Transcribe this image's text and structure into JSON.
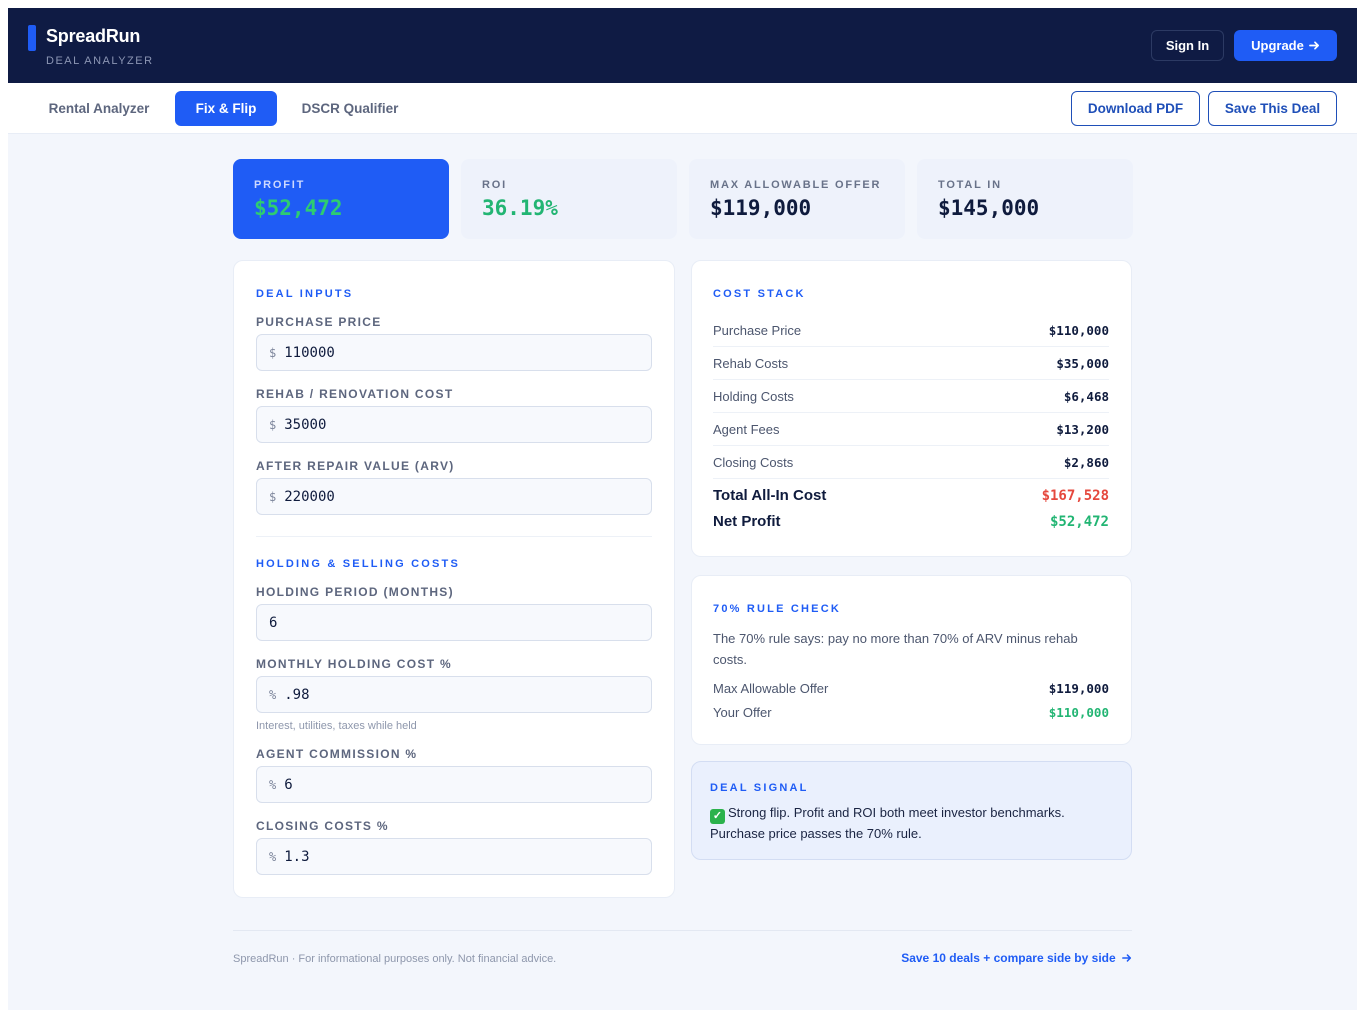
{
  "header": {
    "brand_name": "SpreadRun",
    "brand_subtitle": "DEAL ANALYZER",
    "sign_in_label": "Sign In",
    "upgrade_label": "Upgrade",
    "upgrade_icon": "arrow-right-icon"
  },
  "tabs": [
    {
      "label": "Rental Analyzer",
      "active": false
    },
    {
      "label": "Fix & Flip",
      "active": true
    },
    {
      "label": "DSCR Qualifier",
      "active": false
    }
  ],
  "actions": {
    "download_pdf_label": "Download PDF",
    "save_deal_label": "Save This Deal"
  },
  "metrics": [
    {
      "label": "PROFIT",
      "value": "$52,472"
    },
    {
      "label": "ROI",
      "value": "36.19%"
    },
    {
      "label": "MAX ALLOWABLE OFFER",
      "value": "$119,000"
    },
    {
      "label": "TOTAL IN",
      "value": "$145,000"
    }
  ],
  "inputs": {
    "deal_section_title": "DEAL INPUTS",
    "purchase_price": {
      "label": "PURCHASE PRICE",
      "prefix": "$",
      "value": "110000"
    },
    "rehab_cost": {
      "label": "REHAB / RENOVATION COST",
      "prefix": "$",
      "value": "35000"
    },
    "arv": {
      "label": "AFTER REPAIR VALUE (ARV)",
      "prefix": "$",
      "value": "220000"
    },
    "holding_section_title": "HOLDING & SELLING COSTS",
    "holding_period": {
      "label": "HOLDING PERIOD (MONTHS)",
      "value": "6"
    },
    "monthly_holding": {
      "label": "MONTHLY HOLDING COST %",
      "prefix": "%",
      "value": ".98",
      "hint": "Interest, utilities, taxes while held"
    },
    "agent_commission": {
      "label": "AGENT COMMISSION %",
      "prefix": "%",
      "value": "6"
    },
    "closing_costs": {
      "label": "CLOSING COSTS %",
      "prefix": "%",
      "value": "1.3"
    }
  },
  "cost_stack": {
    "title": "COST STACK",
    "rows": [
      {
        "label": "Purchase Price",
        "value": "$110,000"
      },
      {
        "label": "Rehab Costs",
        "value": "$35,000"
      },
      {
        "label": "Holding Costs",
        "value": "$6,468"
      },
      {
        "label": "Agent Fees",
        "value": "$13,200"
      },
      {
        "label": "Closing Costs",
        "value": "$2,860"
      }
    ],
    "total_label": "Total All-In Cost",
    "total_value": "$167,528",
    "profit_label": "Net Profit",
    "profit_value": "$52,472"
  },
  "rule_check": {
    "title": "70% RULE CHECK",
    "description": "The 70% rule says: pay no more than 70% of ARV minus rehab costs.",
    "max_offer_label": "Max Allowable Offer",
    "max_offer_value": "$119,000",
    "your_offer_label": "Your Offer",
    "your_offer_value": "$110,000"
  },
  "signal": {
    "title": "DEAL SIGNAL",
    "icon": "check-mark-icon",
    "text": "Strong flip. Profit and ROI both meet investor benchmarks. Purchase price passes the 70% rule."
  },
  "footer": {
    "note": "SpreadRun · For informational purposes only. Not financial advice.",
    "link": "Save 10 deals + compare side by side"
  },
  "colors": {
    "navy": "#0f1b44",
    "accent": "#1f5cf5",
    "positive": "#22b573",
    "negative": "#e5483d"
  }
}
